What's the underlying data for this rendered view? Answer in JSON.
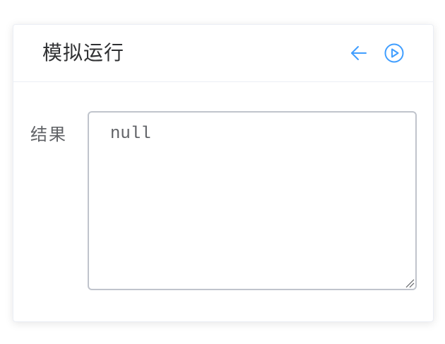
{
  "card": {
    "title": "模拟运行",
    "actions": {
      "back_icon": "arrow-left-icon",
      "run_icon": "play-circle-icon"
    }
  },
  "result": {
    "label": "结果",
    "value": "null"
  },
  "colors": {
    "accent": "#409eff",
    "title_text": "#303133",
    "label_text": "#606266",
    "border": "#c0c4cc",
    "divider": "#ebeef5"
  }
}
